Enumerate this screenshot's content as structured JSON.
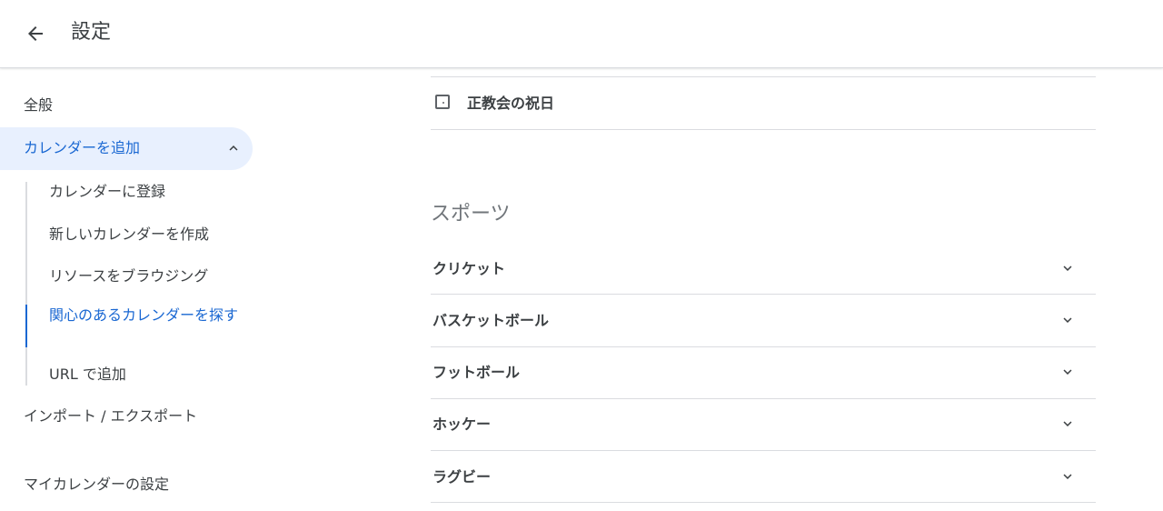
{
  "header": {
    "title": "設定"
  },
  "sidebar": {
    "items": [
      {
        "label": "全般"
      },
      {
        "label": "カレンダーを追加"
      },
      {
        "label": "インポート / エクスポート"
      },
      {
        "label": "マイカレンダーの設定"
      }
    ],
    "sub_items": [
      {
        "label": "カレンダーに登録"
      },
      {
        "label": "新しいカレンダーを作成"
      },
      {
        "label": "リソースをブラウジング"
      },
      {
        "label": "関心のあるカレンダーを探す"
      },
      {
        "label": "URL で追加"
      }
    ]
  },
  "main": {
    "checkbox_label": "正教会の祝日",
    "section_title": "スポーツ",
    "accordions": [
      {
        "label": "クリケット"
      },
      {
        "label": "バスケットボール"
      },
      {
        "label": "フットボール"
      },
      {
        "label": "ホッケー"
      },
      {
        "label": "ラグビー"
      }
    ]
  },
  "colors": {
    "accent": "#1967d2",
    "active_bg": "#e8f0fe",
    "text": "#3c4043",
    "divider": "#dadce0"
  }
}
